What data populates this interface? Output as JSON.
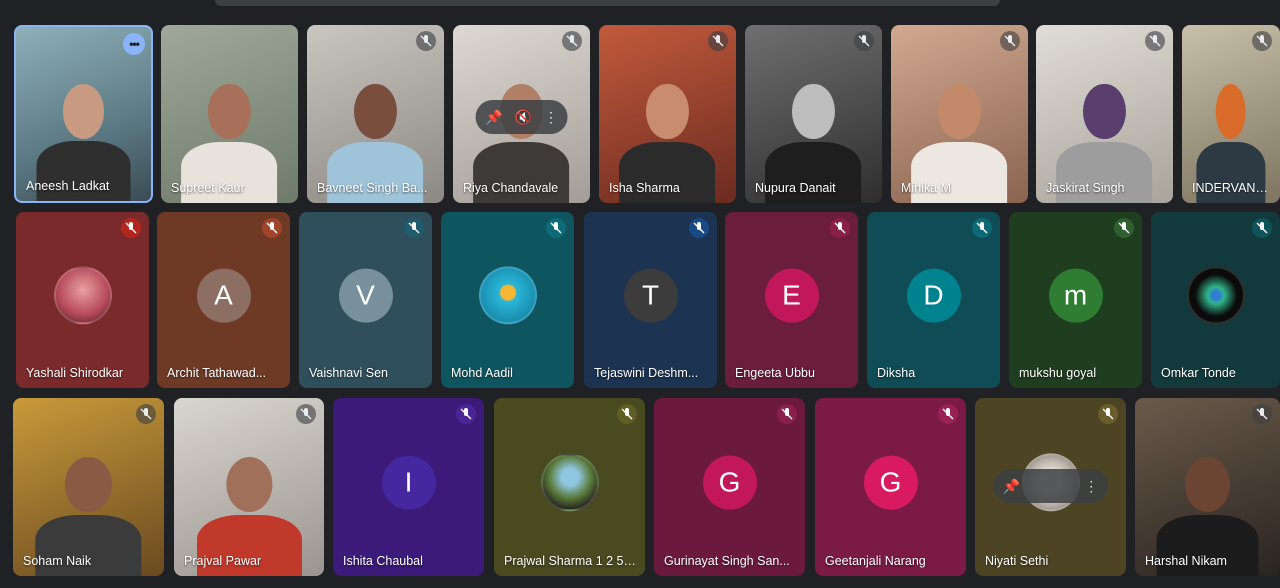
{
  "participants": [
    {
      "name": "Aneesh Ladkat",
      "mic": "more"
    },
    {
      "name": "Supreet Kaur",
      "mic": "none"
    },
    {
      "name": "Bavneet Singh Ba...",
      "mic": "muted"
    },
    {
      "name": "Riya Chandavale",
      "mic": "muted"
    },
    {
      "name": "Isha Sharma",
      "mic": "muted"
    },
    {
      "name": "Nupura Danait",
      "mic": "muted"
    },
    {
      "name": "Mihika M",
      "mic": "muted"
    },
    {
      "name": "Jaskirat Singh",
      "mic": "muted"
    },
    {
      "name": "INDERVANS...",
      "mic": "muted"
    },
    {
      "name": "Yashali Shirodkar",
      "mic": "muted"
    },
    {
      "name": "Archit Tathawad...",
      "initial": "A",
      "mic": "muted"
    },
    {
      "name": "Vaishnavi Sen",
      "initial": "V",
      "mic": "muted"
    },
    {
      "name": "Mohd Aadil",
      "mic": "muted"
    },
    {
      "name": "Tejaswini Deshm...",
      "initial": "T",
      "mic": "muted"
    },
    {
      "name": "Engeeta Ubbu",
      "initial": "E",
      "mic": "muted"
    },
    {
      "name": "Diksha",
      "initial": "D",
      "mic": "muted"
    },
    {
      "name": "mukshu goyal",
      "initial": "m",
      "mic": "muted"
    },
    {
      "name": "Omkar Tonde",
      "mic": "muted"
    },
    {
      "name": "Soham Naik",
      "mic": "muted"
    },
    {
      "name": "Prajval Pawar",
      "mic": "muted"
    },
    {
      "name": "Ishita Chaubal",
      "initial": "I",
      "mic": "muted"
    },
    {
      "name": "Prajwal Sharma 1 2 5 ...",
      "mic": "muted"
    },
    {
      "name": "Gurinayat Singh San...",
      "initial": "G",
      "mic": "muted"
    },
    {
      "name": "Geetanjali Narang",
      "initial": "G",
      "mic": "muted"
    },
    {
      "name": "Niyati Sethi",
      "mic": "muted"
    },
    {
      "name": "Harshal Nikam",
      "mic": "muted"
    }
  ],
  "hover_controls": {
    "pin_icon": "pin-icon",
    "mute_icon": "mic-off-icon",
    "more_icon": "more-vert-icon"
  },
  "colors": {
    "background": "#202124",
    "active_border": "#8ab4f8"
  }
}
